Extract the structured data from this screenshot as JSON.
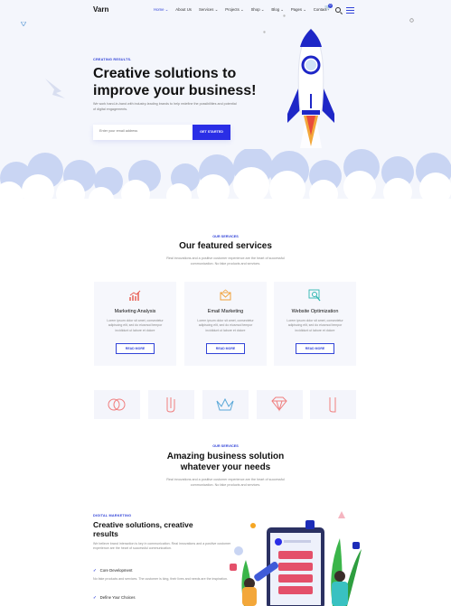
{
  "brand": {
    "name": "Varn"
  },
  "nav": {
    "items": [
      "Home ⌄",
      "About Us",
      "Services ⌄",
      "Projects ⌄",
      "Shop ⌄",
      "Blog ⌄",
      "Pages ⌄",
      "Contact"
    ],
    "cart_count": "0"
  },
  "hero": {
    "eyebrow": "CREATING RESULTS.",
    "title_line1": "Creative solutions to",
    "title_line2": "improve your business!",
    "lead": "We work hand-in-hand with industry-leading brands to help redefine the possibilities and potential of digital engagements.",
    "email_placeholder": "Enter your email address",
    "cta": "GET STARTED"
  },
  "services": {
    "eyebrow": "OUR SERVICES",
    "title": "Our featured services",
    "subtitle": "Real innovations and a positive customer experience are the heart of successful communication. No fake products and services.",
    "cards": [
      {
        "title": "Marketing Analysis",
        "text": "Lorem ipsum dolor sit amet, consectetur adipiscing elit, sed do eiusmod tempor incididunt ut labore et dolore",
        "button": "READ MORE",
        "icon": "chart-icon"
      },
      {
        "title": "Email Marketing",
        "text": "Lorem ipsum dolor sit amet, consectetur adipiscing elit, sed do eiusmod tempor incididunt ut labore et dolore",
        "button": "READ MORE",
        "icon": "envelope-icon"
      },
      {
        "title": "Website Optimization",
        "text": "Lorem ipsum dolor sit amet, consectetur adipiscing elit, sed do eiusmod tempor incididunt ut labore et dolore",
        "button": "READ MORE",
        "icon": "magnifier-icon"
      }
    ]
  },
  "solutions": {
    "eyebrow": "OUR SERVICES",
    "title_line1": "Amazing business solution",
    "title_line2": "whatever your needs",
    "subtitle": "Real innovations and a positive customer experience are the heart of successful communication. No fake products and services."
  },
  "digital": {
    "eyebrow": "DIGITAL MARKETING",
    "title": "Creative solutions, creative results",
    "para1": "We believe brand interaction is key in communication. Real innovations and a positive customer experience are the heart of successful communication.",
    "para2": "No fake products and services. The customer is king, their lives and needs are the inspiration.",
    "checks": [
      "Core Development",
      "Define Your Choices"
    ]
  },
  "colors": {
    "accent": "#2a2ee6",
    "hero_bg": "#f4f6fc",
    "cloud": "#c7d3f3"
  }
}
